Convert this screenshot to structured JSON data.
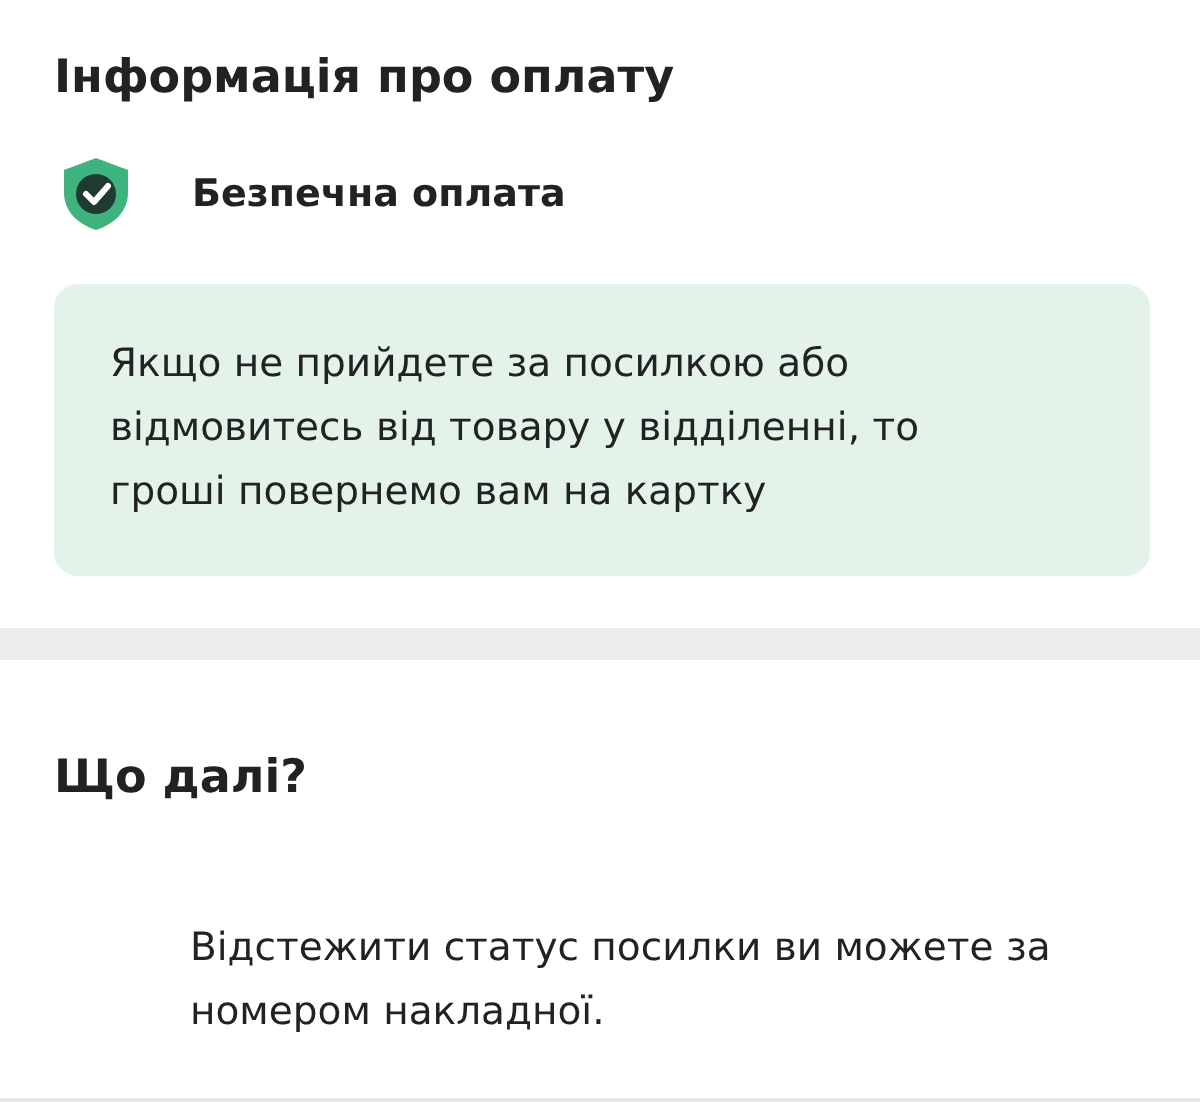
{
  "payment": {
    "title": "Інформація про оплату",
    "secure_label": "Безпечна оплата",
    "notice": "Якщо не прийдете за посилкою або відмовитесь від товару у відділенні, то гроші повернемо вам на картку"
  },
  "next": {
    "title": "Що далі?",
    "text": "Відстежити статус посилки ви можете за номером накладної."
  }
}
